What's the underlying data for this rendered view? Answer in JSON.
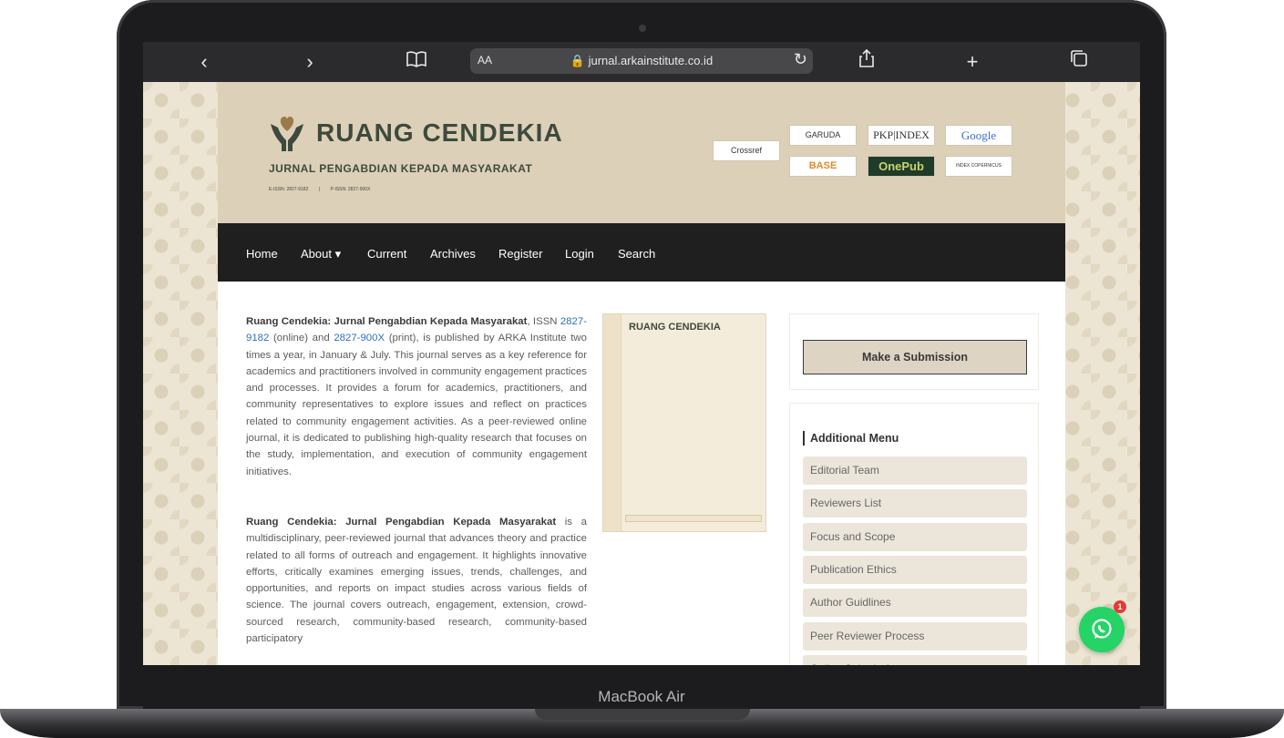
{
  "device": {
    "label": "MacBook Air"
  },
  "browser": {
    "text_size_label": "AA",
    "url": "jurnal.arkainstitute.co.id"
  },
  "header": {
    "title": "RUANG CENDEKIA",
    "subtitle": "JURNAL PENGABDIAN KEPADA MASYARAKAT",
    "eissn": "E-ISSN: 2827-9182",
    "pissn": "P-ISSN: 2827-900X",
    "indexers": [
      "Crossref",
      "GARUDA",
      "PKP|INDEX",
      "Google",
      "BASE",
      "OnePub",
      "INDEX COPERNICUS"
    ]
  },
  "nav": {
    "items": [
      "Home",
      "About ▾",
      "Current",
      "Archives",
      "Register",
      "Login",
      "Search"
    ]
  },
  "main": {
    "p1_bold": "Ruang Cendekia: Jurnal Pengabdian Kepada Masyarakat",
    "p1_issn_lead": ", ISSN ",
    "p1_eissn_link": "2827-9182",
    "p1_and": " (online) and ",
    "p1_pissn_link": "2827-900X",
    "p1_rest": " (print), is published by ARKA Institute two times a year, in January & July. This journal serves as a key reference for academics and practitioners involved in community engagement practices and processes. It provides a forum for academics, practitioners, and community representatives to explore issues and reflect on practices related to community engagement activities. As a peer-reviewed online journal, it is dedicated to publishing high-quality research that focuses on the study, implementation, and execution of community engagement initiatives.",
    "p2_bold": "Ruang Cendekia: Jurnal Pengabdian Kepada Masyarakat",
    "p2_rest": " is a multidisciplinary, peer-reviewed journal that advances theory and practice related to all forms of outreach and engagement. It highlights innovative efforts, critically examines emerging issues, trends, challenges, and opportunities, and reports on impact studies across various fields of science. The journal covers outreach, engagement, extension, crowd-sourced research, community-based research, community-based participatory",
    "cover_title": "RUANG CENDEKIA"
  },
  "sidebar": {
    "submit_label": "Make a Submission",
    "menu_heading": "Additional Menu",
    "menu_items": [
      "Editorial Team",
      "Reviewers List",
      "Focus and Scope",
      "Publication Ethics",
      "Author Guidlines",
      "Peer Reviewer Process",
      "Online Submissions"
    ]
  },
  "whatsapp": {
    "badge_count": "1"
  },
  "colors": {
    "header_bg": "#ddd0b8",
    "nav_bg": "#1f1f1f",
    "link": "#2f6fbf",
    "accent_green": "#3d4a3d"
  }
}
